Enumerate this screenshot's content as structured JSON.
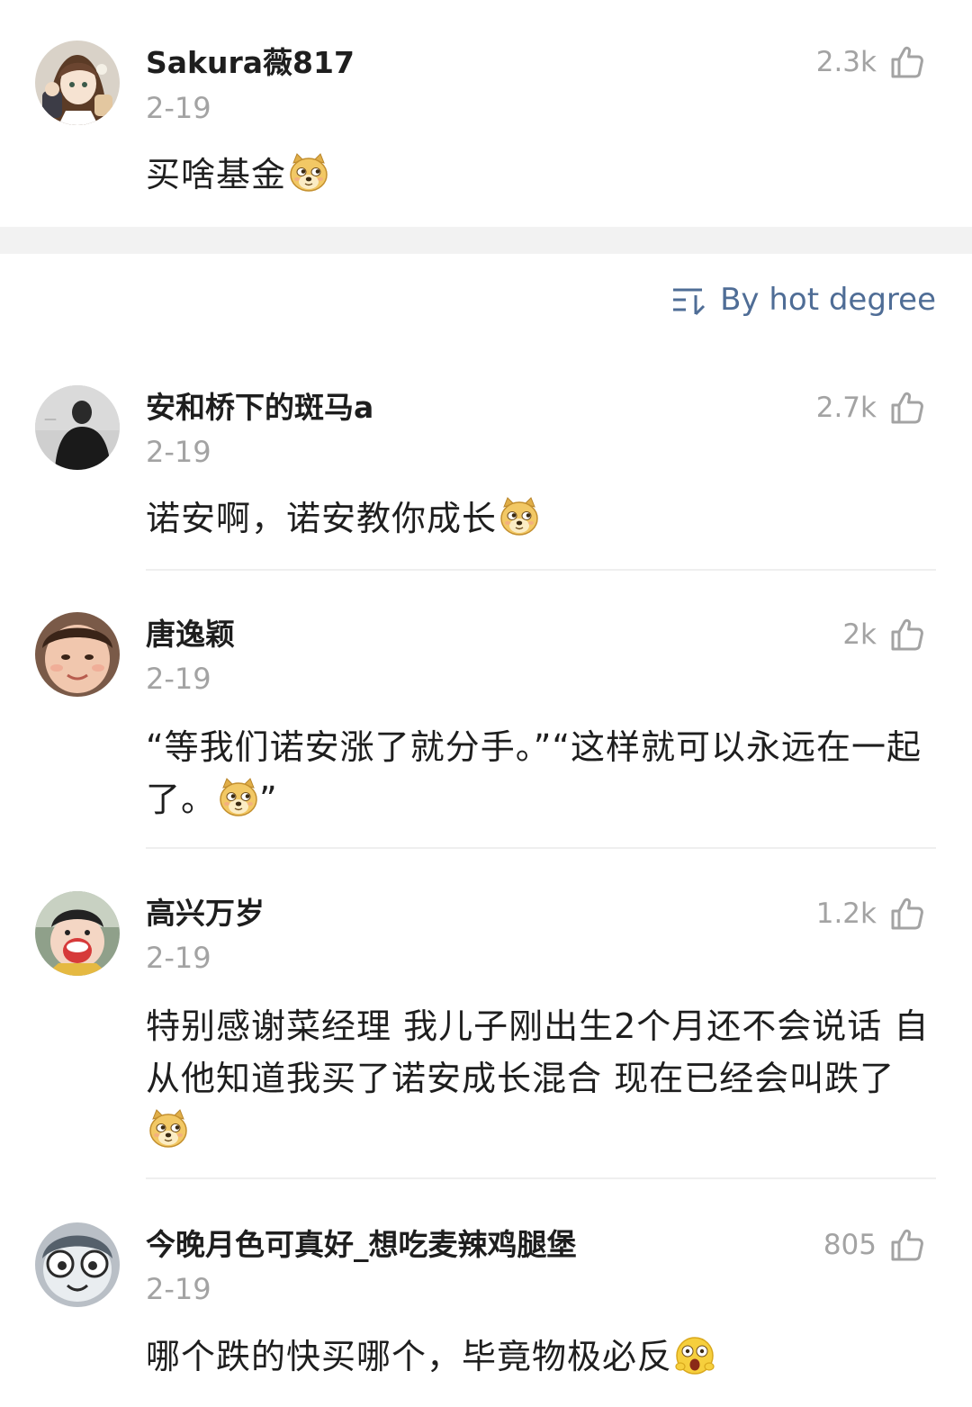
{
  "post": {
    "username": "Sakura薇817",
    "date": "2-19",
    "likes": "2.3k",
    "text": "买啥基金",
    "emoji_icon": "doge-emoji-icon"
  },
  "sort": {
    "label": "By hot degree",
    "icon": "sort-icon"
  },
  "comments": [
    {
      "username": "安和桥下的斑马a",
      "date": "2-19",
      "likes": "2.7k",
      "text": "诺安啊，诺安教你成长",
      "emoji_icon": "doge-emoji-icon"
    },
    {
      "username": "唐逸颖",
      "date": "2-19",
      "likes": "2k",
      "text": "“等我们诺安涨了就分手。”“这样就可以永远在一起了。",
      "text_end": "”",
      "emoji_icon": "doge-emoji-icon"
    },
    {
      "username": "高兴万岁",
      "date": "2-19",
      "likes": "1.2k",
      "text": "特别感谢菜经理 我儿子刚出生2个月还不会说话 自从他知道我买了诺安成长混合 现在已经会叫跌了",
      "emoji_icon": "doge-emoji-icon"
    },
    {
      "username": "今晚月色可真好_想吃麦辣鸡腿堡",
      "date": "2-19",
      "likes": "805",
      "text": "哪个跌的快买哪个，毕竟物极必反",
      "emoji_icon": "shocked-emoji-icon"
    }
  ],
  "colors": {
    "accent_link": "#4f6d96",
    "meta_gray": "#a3a3a3",
    "separator": "#f2f2f2"
  }
}
